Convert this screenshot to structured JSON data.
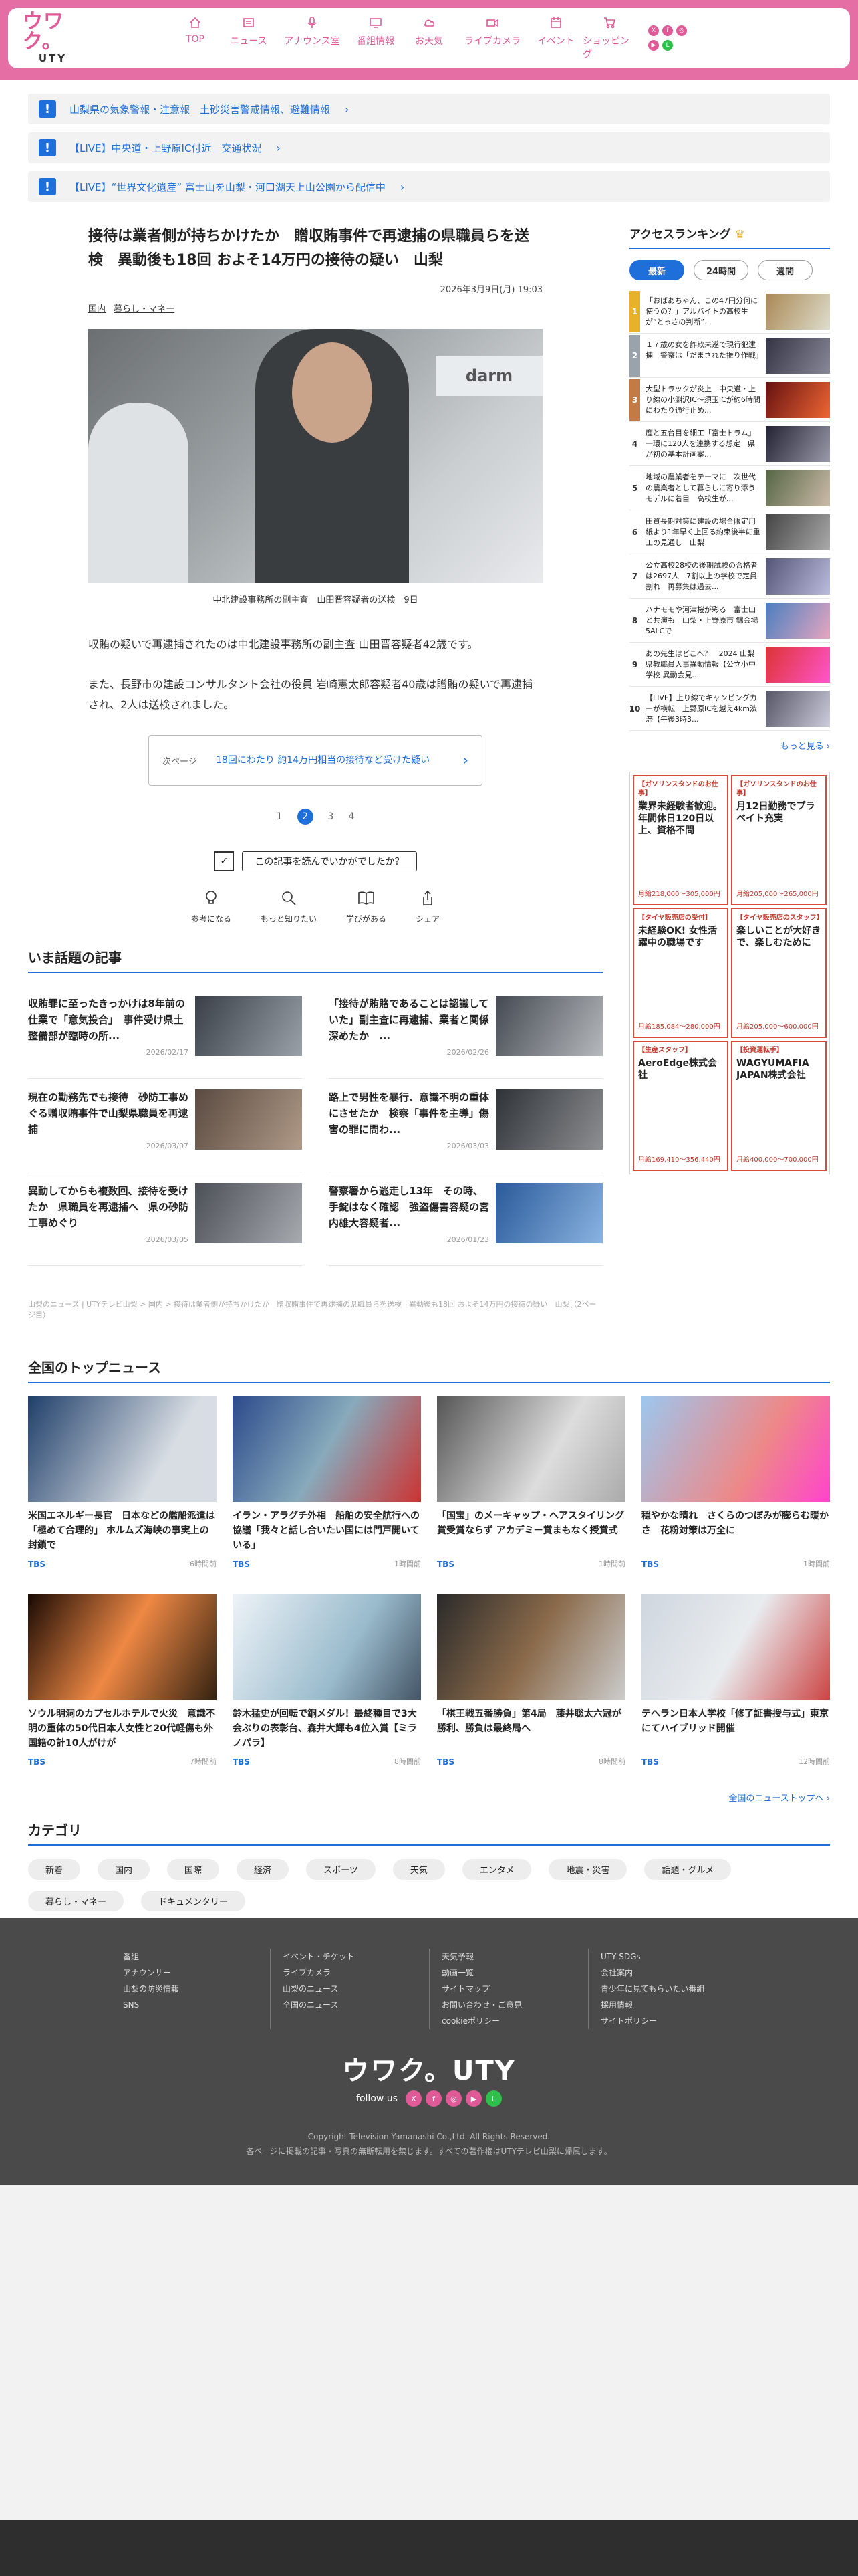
{
  "header": {
    "logo_main": "ウワク。",
    "logo_sub": "UTY",
    "nav": [
      {
        "label": "TOP",
        "icon": "home-icon"
      },
      {
        "label": "ニュース",
        "icon": "news-icon"
      },
      {
        "label": "アナウンス室",
        "icon": "microphone-icon"
      },
      {
        "label": "番組情報",
        "icon": "tv-icon"
      },
      {
        "label": "お天気",
        "icon": "weather-icon"
      },
      {
        "label": "ライブカメラ",
        "icon": "camera-icon"
      },
      {
        "label": "イベント",
        "icon": "calendar-icon"
      },
      {
        "label": "ショッピング",
        "icon": "cart-icon"
      }
    ]
  },
  "alerts": [
    {
      "badge": "!",
      "text": "山梨県の気象警報・注意報　土砂災害警戒情報、避難情報"
    },
    {
      "badge": "!",
      "text": "【LIVE】中央道・上野原IC付近　交通状況"
    },
    {
      "badge": "!",
      "text": "【LIVE】“世界文化遺産” 富士山を山梨・河口湖天上山公園から配信中"
    }
  ],
  "article": {
    "headline": "接待は業者側が持ちかけたか　贈収賄事件で再逮捕の県職員らを送検　異動後も18回 およそ14万円の接待の疑い　山梨",
    "date": "2026年3月9日(月) 19:03",
    "tags": [
      "国内",
      "暮らし・マネー"
    ],
    "photo_text": "darm",
    "caption": "中北建設事務所の副主査　山田晋容疑者の送検　9日",
    "paragraphs": [
      "収賄の疑いで再逮捕されたのは中北建設事務所の副主査 山田晋容疑者42歳です。",
      "また、長野市の建設コンサルタント会社の役員 岩崎憲太郎容疑者40歳は贈賄の疑いで再逮捕され、2人は送検されました。"
    ],
    "next_label": "次ページ",
    "next_text": "18回にわたり 約14万円相当の接待など受けた疑い",
    "pages": [
      "1",
      "2",
      "3",
      "4"
    ],
    "active_page": "2",
    "feedback": "この記事を読んでいかがでしたか？",
    "reactions": [
      "参考になる",
      "もっと知りたい",
      "学びがある",
      "シェア"
    ]
  },
  "topics": {
    "title": "いま話題の記事",
    "items": [
      {
        "title": "収賄罪に至ったきっかけは8年前の仕業で「意気投合」　事件受け県土整備部が臨時の所...",
        "date": "2026/02/17"
      },
      {
        "title": "「接待が賄賂であることは認識していた」副主査に再逮捕、業者と関係深めたか　...",
        "date": "2026/02/26"
      },
      {
        "title": "現在の勤務先でも接待　砂防工事めぐる贈収賄事件で山梨県職員を再逮捕",
        "date": "2026/03/07"
      },
      {
        "title": "路上で男性を暴行、意識不明の重体にさせたか　検察「事件を主導」傷害の罪に問わ...",
        "date": "2026/03/03"
      },
      {
        "title": "異動してからも複数回、接待を受けたか　県職員を再逮捕へ　県の砂防工事めぐり",
        "date": "2026/03/05"
      },
      {
        "title": "警察署から逃走し13年　その時、手錠はなく確認　強盗傷害容疑の宮内雄大容疑者...",
        "date": "2026/01/23"
      }
    ]
  },
  "breadcrumb": "山梨のニュース | UTYテレビ山梨 > 国内 > 接待は業者側が持ちかけたか　贈収賄事件で再逮捕の県職員らを送検　異動後も18回 およそ14万円の接待の疑い　山梨（2ページ目）",
  "ranking": {
    "title": "アクセスランキング",
    "crown": "♛",
    "tabs": [
      "最新",
      "24時間",
      "週間"
    ],
    "items": [
      {
        "no": "1",
        "text": "「おばあちゃん、この47円分何に使うの？」アルバイトの高校生が“とっさの判断”..."
      },
      {
        "no": "2",
        "text": "１７歳の女を詐欺未遂で現行犯逮捕　警察は「だまされた振り作戦」"
      },
      {
        "no": "3",
        "text": "大型トラックが炎上　中央道・上り線の小淵沢IC〜須玉ICが約6時間にわたり通行止め..."
      },
      {
        "no": "4",
        "text": "鹿と五台目を細工「富士トラム」一環に120人を連携する想定　県が初の基本計画案..."
      },
      {
        "no": "5",
        "text": "地域の農業者をテーマに　次世代の農業者として暮らしに寄り添うモデルに着目　高校生が..."
      },
      {
        "no": "6",
        "text": "田質長期対策に建設の場合限定用紙より1年早く上回る約束後半に重工の見通し　山梨"
      },
      {
        "no": "7",
        "text": "公立高校28校の後期試験の合格者は2697人　7割以上の学校で定員割れ　再募集は過去..."
      },
      {
        "no": "8",
        "text": "ハナモモや河津桜が彩る　富士山と共演も　山梨・上野原市 錦会場5ALCで"
      },
      {
        "no": "9",
        "text": "あの先生はどこへ？　2024 山梨県教職員人事異動情報【公立小中学校 異動会見..."
      },
      {
        "no": "10",
        "text": "【LIVE】上り線でキャンピングカーが横転　上野原ICを越え4km渋滞【午後3時3..."
      }
    ],
    "more": "もっと見る ›"
  },
  "ads": [
    {
      "head": "【ガソリンスタンドのお仕事】",
      "big": "業界未経験者歓迎。年間休日120日以上、資格不問",
      "pay": "月給218,000〜305,000円"
    },
    {
      "head": "【ガソリンスタンドのお仕事】",
      "big": "月12日勤務でプラベイト充実",
      "pay": "月給205,000〜265,000円"
    },
    {
      "head": "【タイヤ販売店の受付】",
      "big": "未経験OK! 女性活躍中の職場です",
      "pay": "月給185,084〜280,000円"
    },
    {
      "head": "【タイヤ販売店のスタッフ】",
      "big": "楽しいことが大好きで、楽しむために",
      "pay": "月給205,000〜600,000円"
    },
    {
      "head": "【生産スタッフ】",
      "big": "AeroEdge株式会社",
      "pay": "月給169,410〜356,440円"
    },
    {
      "head": "【投資運転手】",
      "big": "WAGYUMAFIA JAPAN株式会社",
      "pay": "月給400,000〜700,000円"
    }
  ],
  "national": {
    "title": "全国のトップニュース",
    "items": [
      {
        "title": "米国エネルギー長官　日本などの艦船派遣は「極めて合理的」 ホルムズ海峡の事実上の封鎖で",
        "src": "TBS",
        "time": "6時間前"
      },
      {
        "title": "イラン・アラグチ外相　船舶の安全航行への協議「我々と話し合いたい国には門戸開いている」",
        "src": "TBS",
        "time": "1時間前"
      },
      {
        "title": "「国宝」のメーキャップ・ヘアスタイリング賞受賞ならず アカデミー賞まもなく授賞式",
        "src": "TBS",
        "time": "1時間前"
      },
      {
        "title": "穏やかな晴れ　さくらのつぼみが膨らむ暖かさ　花粉対策は万全に",
        "src": "TBS",
        "time": "1時間前"
      },
      {
        "title": "ソウル明洞のカプセルホテルで火災　意識不明の重体の50代日本人女性と20代軽傷も外国籍の計10人がけが",
        "src": "TBS",
        "time": "7時間前"
      },
      {
        "title": "鈴木猛史が回転で銅メダル！最終種目で3大会ぶりの表彰台、森井大輝も4位入賞【ミラノパラ】",
        "src": "TBS",
        "time": "8時間前"
      },
      {
        "title": "「棋王戦五番勝負」第4局　藤井聡太六冠が勝利、勝負は最終局へ",
        "src": "TBS",
        "time": "8時間前"
      },
      {
        "title": "テヘラン日本人学校「修了証書授与式」東京にてハイブリッド開催",
        "src": "TBS",
        "time": "12時間前"
      }
    ],
    "more": "全国のニューストップへ ›"
  },
  "categories": {
    "title": "カテゴリ",
    "items": [
      "新着",
      "国内",
      "国際",
      "経済",
      "スポーツ",
      "天気",
      "エンタメ",
      "地震・災害",
      "話題・グルメ",
      "暮らし・マネー",
      "ドキュメンタリー"
    ]
  },
  "footer": {
    "cols": [
      [
        "番組",
        "アナウンサー",
        "山梨の防災情報",
        "SNS"
      ],
      [
        "イベント・チケット",
        "ライブカメラ",
        "山梨のニュース",
        "全国のニュース"
      ],
      [
        "天気予報",
        "動画一覧",
        "サイトマップ",
        "お問い合わせ・ご意見",
        "cookieポリシー"
      ],
      [
        "UTY SDGs",
        "会社案内",
        "青少年に見てもらいたい番組",
        "採用情報",
        "サイトポリシー"
      ]
    ],
    "logo": "ウワク。UTY",
    "follow": "follow us",
    "copyright": "Copyright Television Yamanashi Co.,Ltd. All Rights Reserved.",
    "notice": "各ページに掲載の記事・写真の無断転用を禁じます。すべての著作権はUTYテレビ山梨に帰属します。"
  },
  "colors": {
    "brand": "#e56ea4",
    "accent": "#1e6fd9"
  }
}
